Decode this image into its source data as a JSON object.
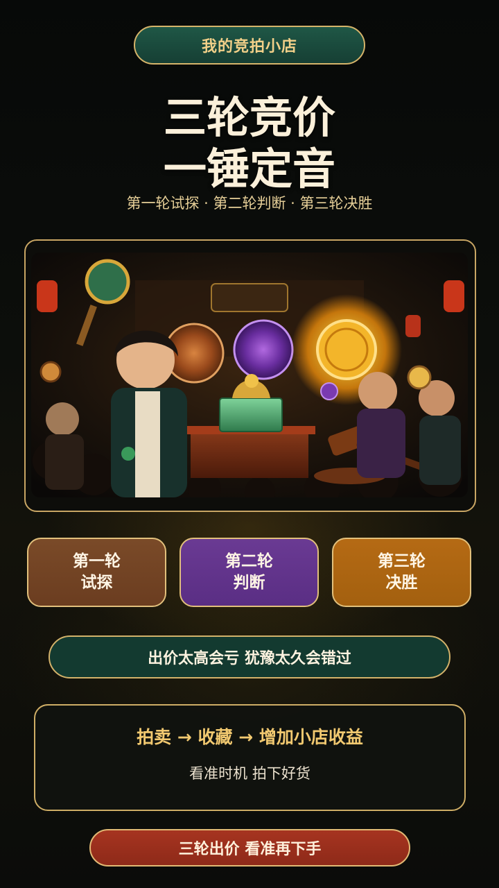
{
  "header": {
    "shop_label": "我的竞拍小店",
    "headline_line1": "三轮竞价",
    "headline_line2": "一锤定音",
    "subtitle": "第一轮试探 · 第二轮判断 · 第三轮决胜"
  },
  "rounds": [
    {
      "line1": "第一轮",
      "line2": "试探",
      "color": "#6b3d20"
    },
    {
      "line1": "第二轮",
      "line2": "判断",
      "color": "#5a2e84"
    },
    {
      "line1": "第三轮",
      "line2": "决胜",
      "color": "#a3600f"
    }
  ],
  "warning": "出价太高会亏  犹豫太久会错过",
  "flow": {
    "title": "拍卖 → 收藏 → 增加小店收益",
    "subtitle": "看准时机  拍下好货"
  },
  "cta": "三轮出价  看准再下手",
  "colors": {
    "accent_gold": "#d6b46a",
    "dark_green": "#163f34",
    "cta_red": "#8e2a19"
  }
}
